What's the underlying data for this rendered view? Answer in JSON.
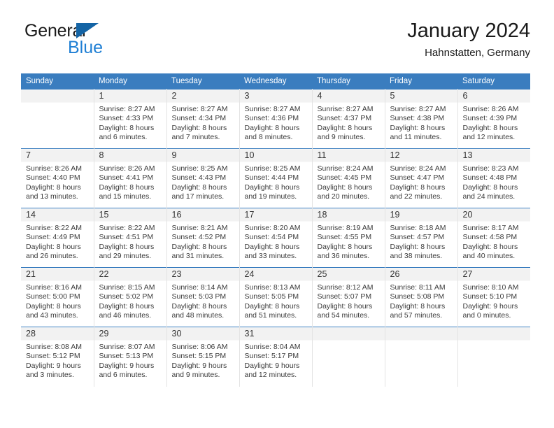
{
  "brand": {
    "name_top": "General",
    "name_bottom": "Blue",
    "accent_color": "#1f7fd4",
    "triangle_color": "#1464a5"
  },
  "header": {
    "title": "January 2024",
    "subtitle": "Hahnstatten, Germany"
  },
  "calendar": {
    "header_bg": "#3a7dbf",
    "weekdays": [
      "Sunday",
      "Monday",
      "Tuesday",
      "Wednesday",
      "Thursday",
      "Friday",
      "Saturday"
    ],
    "weeks": [
      [
        {
          "day": "",
          "sunrise": "",
          "sunset": "",
          "daylight1": "",
          "daylight2": "",
          "empty": true
        },
        {
          "day": "1",
          "sunrise": "Sunrise: 8:27 AM",
          "sunset": "Sunset: 4:33 PM",
          "daylight1": "Daylight: 8 hours",
          "daylight2": "and 6 minutes."
        },
        {
          "day": "2",
          "sunrise": "Sunrise: 8:27 AM",
          "sunset": "Sunset: 4:34 PM",
          "daylight1": "Daylight: 8 hours",
          "daylight2": "and 7 minutes."
        },
        {
          "day": "3",
          "sunrise": "Sunrise: 8:27 AM",
          "sunset": "Sunset: 4:36 PM",
          "daylight1": "Daylight: 8 hours",
          "daylight2": "and 8 minutes."
        },
        {
          "day": "4",
          "sunrise": "Sunrise: 8:27 AM",
          "sunset": "Sunset: 4:37 PM",
          "daylight1": "Daylight: 8 hours",
          "daylight2": "and 9 minutes."
        },
        {
          "day": "5",
          "sunrise": "Sunrise: 8:27 AM",
          "sunset": "Sunset: 4:38 PM",
          "daylight1": "Daylight: 8 hours",
          "daylight2": "and 11 minutes."
        },
        {
          "day": "6",
          "sunrise": "Sunrise: 8:26 AM",
          "sunset": "Sunset: 4:39 PM",
          "daylight1": "Daylight: 8 hours",
          "daylight2": "and 12 minutes."
        }
      ],
      [
        {
          "day": "7",
          "sunrise": "Sunrise: 8:26 AM",
          "sunset": "Sunset: 4:40 PM",
          "daylight1": "Daylight: 8 hours",
          "daylight2": "and 13 minutes."
        },
        {
          "day": "8",
          "sunrise": "Sunrise: 8:26 AM",
          "sunset": "Sunset: 4:41 PM",
          "daylight1": "Daylight: 8 hours",
          "daylight2": "and 15 minutes."
        },
        {
          "day": "9",
          "sunrise": "Sunrise: 8:25 AM",
          "sunset": "Sunset: 4:43 PM",
          "daylight1": "Daylight: 8 hours",
          "daylight2": "and 17 minutes."
        },
        {
          "day": "10",
          "sunrise": "Sunrise: 8:25 AM",
          "sunset": "Sunset: 4:44 PM",
          "daylight1": "Daylight: 8 hours",
          "daylight2": "and 19 minutes."
        },
        {
          "day": "11",
          "sunrise": "Sunrise: 8:24 AM",
          "sunset": "Sunset: 4:45 PM",
          "daylight1": "Daylight: 8 hours",
          "daylight2": "and 20 minutes."
        },
        {
          "day": "12",
          "sunrise": "Sunrise: 8:24 AM",
          "sunset": "Sunset: 4:47 PM",
          "daylight1": "Daylight: 8 hours",
          "daylight2": "and 22 minutes."
        },
        {
          "day": "13",
          "sunrise": "Sunrise: 8:23 AM",
          "sunset": "Sunset: 4:48 PM",
          "daylight1": "Daylight: 8 hours",
          "daylight2": "and 24 minutes."
        }
      ],
      [
        {
          "day": "14",
          "sunrise": "Sunrise: 8:22 AM",
          "sunset": "Sunset: 4:49 PM",
          "daylight1": "Daylight: 8 hours",
          "daylight2": "and 26 minutes."
        },
        {
          "day": "15",
          "sunrise": "Sunrise: 8:22 AM",
          "sunset": "Sunset: 4:51 PM",
          "daylight1": "Daylight: 8 hours",
          "daylight2": "and 29 minutes."
        },
        {
          "day": "16",
          "sunrise": "Sunrise: 8:21 AM",
          "sunset": "Sunset: 4:52 PM",
          "daylight1": "Daylight: 8 hours",
          "daylight2": "and 31 minutes."
        },
        {
          "day": "17",
          "sunrise": "Sunrise: 8:20 AM",
          "sunset": "Sunset: 4:54 PM",
          "daylight1": "Daylight: 8 hours",
          "daylight2": "and 33 minutes."
        },
        {
          "day": "18",
          "sunrise": "Sunrise: 8:19 AM",
          "sunset": "Sunset: 4:55 PM",
          "daylight1": "Daylight: 8 hours",
          "daylight2": "and 36 minutes."
        },
        {
          "day": "19",
          "sunrise": "Sunrise: 8:18 AM",
          "sunset": "Sunset: 4:57 PM",
          "daylight1": "Daylight: 8 hours",
          "daylight2": "and 38 minutes."
        },
        {
          "day": "20",
          "sunrise": "Sunrise: 8:17 AM",
          "sunset": "Sunset: 4:58 PM",
          "daylight1": "Daylight: 8 hours",
          "daylight2": "and 40 minutes."
        }
      ],
      [
        {
          "day": "21",
          "sunrise": "Sunrise: 8:16 AM",
          "sunset": "Sunset: 5:00 PM",
          "daylight1": "Daylight: 8 hours",
          "daylight2": "and 43 minutes."
        },
        {
          "day": "22",
          "sunrise": "Sunrise: 8:15 AM",
          "sunset": "Sunset: 5:02 PM",
          "daylight1": "Daylight: 8 hours",
          "daylight2": "and 46 minutes."
        },
        {
          "day": "23",
          "sunrise": "Sunrise: 8:14 AM",
          "sunset": "Sunset: 5:03 PM",
          "daylight1": "Daylight: 8 hours",
          "daylight2": "and 48 minutes."
        },
        {
          "day": "24",
          "sunrise": "Sunrise: 8:13 AM",
          "sunset": "Sunset: 5:05 PM",
          "daylight1": "Daylight: 8 hours",
          "daylight2": "and 51 minutes."
        },
        {
          "day": "25",
          "sunrise": "Sunrise: 8:12 AM",
          "sunset": "Sunset: 5:07 PM",
          "daylight1": "Daylight: 8 hours",
          "daylight2": "and 54 minutes."
        },
        {
          "day": "26",
          "sunrise": "Sunrise: 8:11 AM",
          "sunset": "Sunset: 5:08 PM",
          "daylight1": "Daylight: 8 hours",
          "daylight2": "and 57 minutes."
        },
        {
          "day": "27",
          "sunrise": "Sunrise: 8:10 AM",
          "sunset": "Sunset: 5:10 PM",
          "daylight1": "Daylight: 9 hours",
          "daylight2": "and 0 minutes."
        }
      ],
      [
        {
          "day": "28",
          "sunrise": "Sunrise: 8:08 AM",
          "sunset": "Sunset: 5:12 PM",
          "daylight1": "Daylight: 9 hours",
          "daylight2": "and 3 minutes."
        },
        {
          "day": "29",
          "sunrise": "Sunrise: 8:07 AM",
          "sunset": "Sunset: 5:13 PM",
          "daylight1": "Daylight: 9 hours",
          "daylight2": "and 6 minutes."
        },
        {
          "day": "30",
          "sunrise": "Sunrise: 8:06 AM",
          "sunset": "Sunset: 5:15 PM",
          "daylight1": "Daylight: 9 hours",
          "daylight2": "and 9 minutes."
        },
        {
          "day": "31",
          "sunrise": "Sunrise: 8:04 AM",
          "sunset": "Sunset: 5:17 PM",
          "daylight1": "Daylight: 9 hours",
          "daylight2": "and 12 minutes."
        },
        {
          "day": "",
          "sunrise": "",
          "sunset": "",
          "daylight1": "",
          "daylight2": "",
          "empty": true
        },
        {
          "day": "",
          "sunrise": "",
          "sunset": "",
          "daylight1": "",
          "daylight2": "",
          "empty": true
        },
        {
          "day": "",
          "sunrise": "",
          "sunset": "",
          "daylight1": "",
          "daylight2": "",
          "empty": true
        }
      ]
    ]
  }
}
